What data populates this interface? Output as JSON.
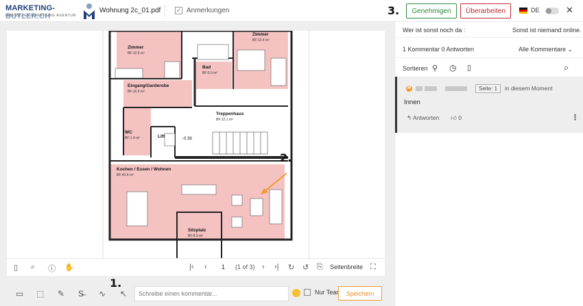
{
  "header": {
    "logo_name_main": "MARKETING-",
    "logo_name_sub": "BUTLER.CH",
    "logo_tagline": "IMMOBILIEN MARKETING AGENTUR",
    "filename": "Wohnung 2c_01.pdf",
    "annotations_label": "Anmerkungen",
    "annotations_checked": "✓",
    "approve_label": "Genehmigen",
    "revise_label": "Überarbeiten",
    "language": "DE",
    "close_icon": "✕",
    "marker_3": "3."
  },
  "floorplan": {
    "rooms": [
      {
        "name": "Zimmer",
        "area": "BF:12.6 m²"
      },
      {
        "name": "Zimmer",
        "area": "BF:13.4 m²"
      },
      {
        "name": "Bad",
        "area": "BF:5.9 m²"
      },
      {
        "name": "Eingang/Garderobe",
        "area": "BF:16.6 m²"
      },
      {
        "name": "Treppenhaus",
        "area": "BF:12.1 m²"
      },
      {
        "name": "WC",
        "area": "BF:1.4 m²"
      },
      {
        "name": "Lift",
        "area": ""
      },
      {
        "name": "Kochen / Essen / Wohnen",
        "area": "BF:43.6 m²"
      },
      {
        "name": "Sitzplatz",
        "area": "BF:8.9 m²"
      }
    ],
    "level": "-0.38",
    "marker_2": "2."
  },
  "navbar": {
    "page": "1",
    "page_of": "(1 of 3)",
    "fit_width": "Seitenbreite"
  },
  "composer": {
    "placeholder": "Schreibe einen kommentar...",
    "team_only": "Nur Team",
    "save": "Speichern",
    "marker_1": "1."
  },
  "panel": {
    "who_label": "Wer ist sonst noch da :",
    "nobody_online": "Sonst ist niemand online.",
    "count_summary": "1 Kommentar 0 Antworten",
    "filter": "Alle Kommentare",
    "sort_label": "Sortieren",
    "comment": {
      "avatar_letter": "M",
      "page": "Seite: 1",
      "time": "in diesem Moment",
      "text": "Innen",
      "reply": "Antworten",
      "likes": "0"
    }
  }
}
